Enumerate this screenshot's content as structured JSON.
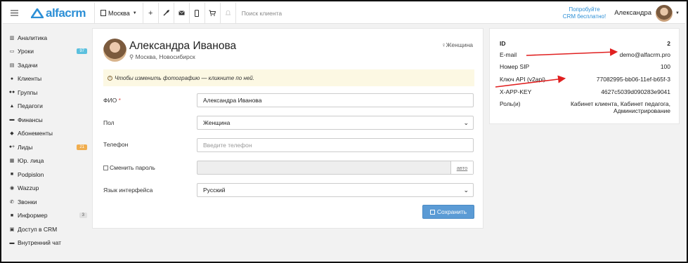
{
  "topbar": {
    "logo_text": "alfacrm",
    "branch": "Москва",
    "search_placeholder": "Поиск клиента",
    "promo_line1": "Попробуйте",
    "promo_line2": "CRM бесплатно!",
    "user_name": "Александра",
    "icons": [
      "plus-icon",
      "wrench-icon",
      "mail-icon",
      "phone-icon",
      "cart-icon",
      "bell-icon"
    ]
  },
  "sidebar": {
    "items": [
      {
        "label": "Аналитика",
        "icon": "book-icon"
      },
      {
        "label": "Уроки",
        "icon": "calendar-icon",
        "badge": "97"
      },
      {
        "label": "Задачи",
        "icon": "tasks-icon"
      },
      {
        "label": "Клиенты",
        "icon": "user-icon"
      },
      {
        "label": "Группы",
        "icon": "users-icon"
      },
      {
        "label": "Педагоги",
        "icon": "graduation-cap-icon"
      },
      {
        "label": "Финансы",
        "icon": "money-icon"
      },
      {
        "label": "Абонементы",
        "icon": "tag-icon"
      },
      {
        "label": "Лиды",
        "icon": "user-plus-icon",
        "badge": "21"
      },
      {
        "label": "Юр. лица",
        "icon": "building-icon"
      },
      {
        "label": "Podpislon",
        "icon": "document-icon"
      },
      {
        "label": "Wazzup",
        "icon": "whatsapp-icon"
      },
      {
        "label": "Звонки",
        "icon": "phone-icon"
      },
      {
        "label": "Информер",
        "icon": "informer-icon",
        "badge": "3"
      },
      {
        "label": "Доступ в CRM",
        "icon": "lock-icon"
      },
      {
        "label": "Внутренний чат",
        "icon": "chat-icon"
      }
    ]
  },
  "profile": {
    "name": "Александра Иванова",
    "city": "Москва, Новосибирск",
    "gender": "Женщина",
    "notice": "Чтобы изменить фотографию — кликните по ней.",
    "form": {
      "fio_label": "ФИО",
      "fio_required": "*",
      "fio_value": "Александра Иванова",
      "gender_label": "Пол",
      "gender_value": "Женщина",
      "phone_label": "Телефон",
      "phone_placeholder": "Введите телефон",
      "password_label": "Сменить пароль",
      "auto_label": "авто",
      "language_label": "Язык интерфейса",
      "language_value": "Русский",
      "save_label": "Сохранить"
    }
  },
  "info": {
    "rows": [
      {
        "key": "ID",
        "value": "2"
      },
      {
        "key": "E-mail",
        "value": "demo@alfacrm.pro"
      },
      {
        "key": "Номер SIP",
        "value": "100"
      },
      {
        "key": "Ключ API (v2api)",
        "value": "77082995-bb06-11ef-b65f-3"
      },
      {
        "key": "X-APP-KEY",
        "value": "4627c5039d090283e9041"
      },
      {
        "key": "Роль(и)",
        "value": "Кабинет клиента, Кабинет педагога,",
        "value2": "Администрирование"
      }
    ]
  },
  "colors": {
    "brand": "#2c8fd6",
    "arrow": "#e02020",
    "notice_bg": "#fcf8e3",
    "save_button": "#5b9bd5"
  }
}
